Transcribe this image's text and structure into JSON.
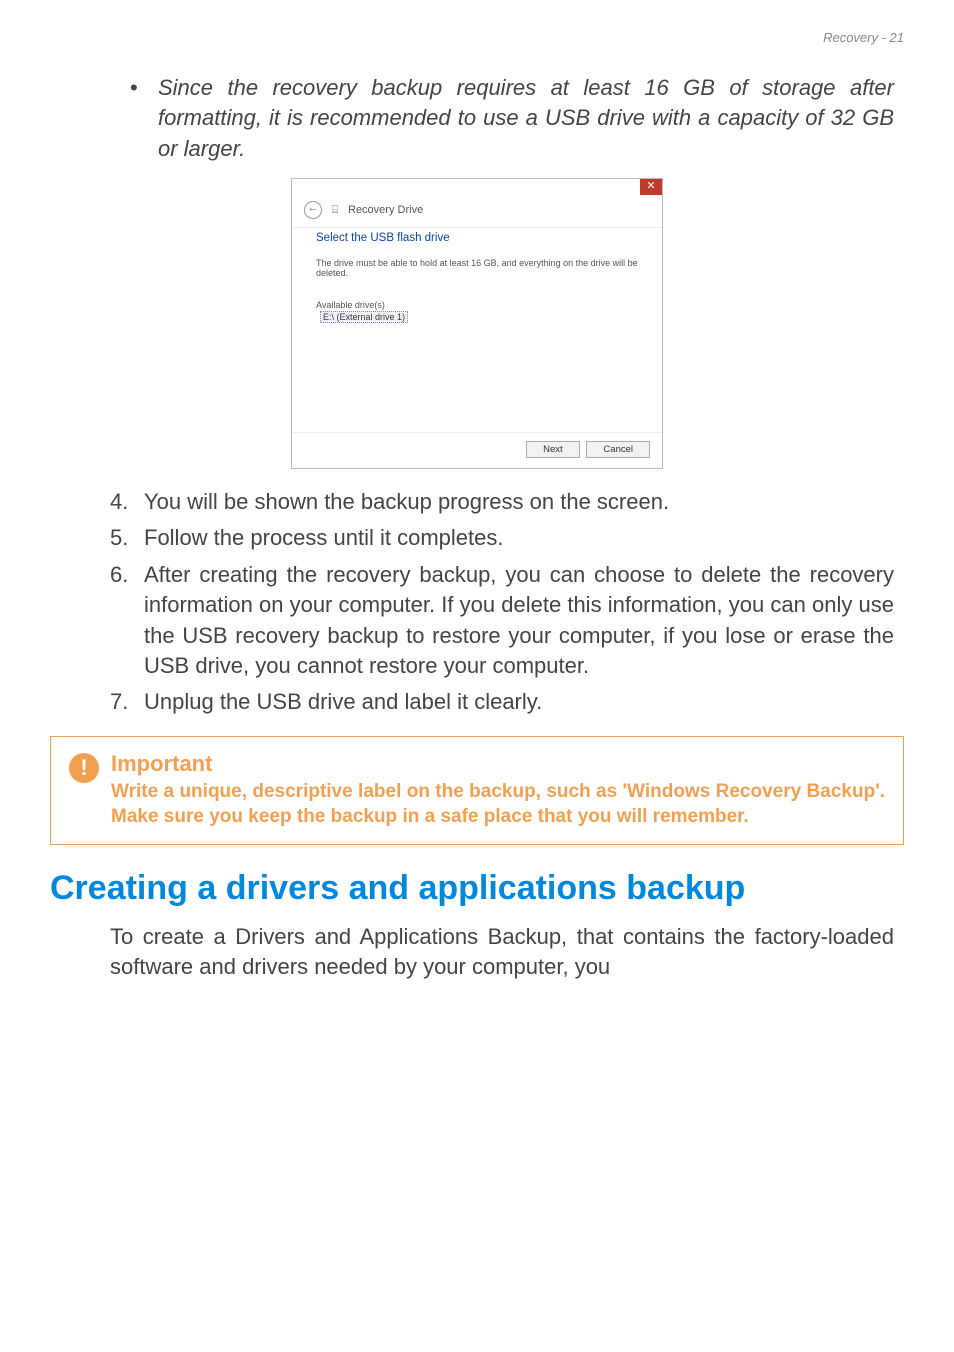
{
  "header": {
    "text": "Recovery - 21"
  },
  "bullet": {
    "dot": "•",
    "text": "Since the recovery backup requires at least 16 GB of storage after formatting, it is recommended to use a USB drive with a capacity of 32 GB or larger."
  },
  "dialog": {
    "close_glyph": "✕",
    "back_glyph": "←",
    "drive_glyph": "⌸",
    "title": "Recovery Drive",
    "heading": "Select the USB flash drive",
    "subtext": "The drive must be able to hold at least 16 GB, and everything on the drive will be deleted.",
    "avail_label": "Available drive(s)",
    "avail_item": "E:\\ (External drive 1)",
    "next": "Next",
    "cancel": "Cancel"
  },
  "steps": {
    "s4": {
      "num": "4.",
      "text": "You will be shown the backup progress on the screen."
    },
    "s5": {
      "num": "5.",
      "text": "Follow the process until it completes."
    },
    "s6": {
      "num": "6.",
      "text": "After creating the recovery backup, you can choose to delete the recovery information on your computer. If you delete this information, you can only use the USB recovery backup to restore your computer, if you lose or erase the USB drive, you cannot restore your computer."
    },
    "s7": {
      "num": "7.",
      "text": "Unplug the USB drive and label it clearly."
    }
  },
  "callout": {
    "icon": "!",
    "title": "Important",
    "text": "Write a unique, descriptive label on the backup, such as 'Windows Recovery Backup'. Make sure you keep the backup in a safe place that you will remember."
  },
  "section": {
    "heading": "Creating a drivers and applications backup",
    "para": "To create a Drivers and Applications Backup, that contains the factory-loaded software and drivers needed by your computer, you"
  }
}
